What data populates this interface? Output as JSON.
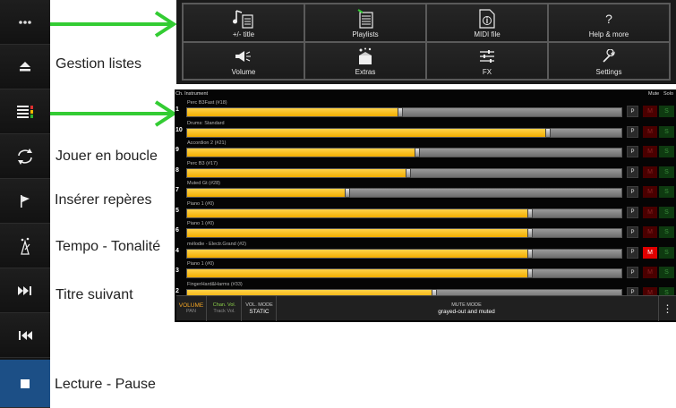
{
  "sidebar": {
    "buttons": [
      {
        "name": "more-icon"
      },
      {
        "name": "eject-icon"
      },
      {
        "name": "playlist-icon"
      },
      {
        "name": "loop-icon"
      },
      {
        "name": "flag-icon"
      },
      {
        "name": "tempo-icon"
      },
      {
        "name": "next-track-icon"
      },
      {
        "name": "restart-icon"
      },
      {
        "name": "stop-icon"
      }
    ]
  },
  "annotations": {
    "gestion_listes": "Gestion listes",
    "jouer_en_boucle": "Jouer en boucle",
    "inserer_reperes": "Insérer repères",
    "tempo_tonalite": "Tempo - Tonalité",
    "titre_suivant": "Titre suivant",
    "lecture_pause": "Lecture - Pause"
  },
  "menu": {
    "items": [
      {
        "label": "+/- title",
        "icon": "add-title-icon"
      },
      {
        "label": "Playlists",
        "icon": "playlists-icon"
      },
      {
        "label": "MIDI file",
        "icon": "midi-file-icon"
      },
      {
        "label": "Help & more",
        "icon": "help-icon"
      },
      {
        "label": "Volume",
        "icon": "volume-icon"
      },
      {
        "label": "Extras",
        "icon": "extras-icon"
      },
      {
        "label": "FX",
        "icon": "fx-icon"
      },
      {
        "label": "Settings",
        "icon": "settings-icon"
      }
    ]
  },
  "mixer": {
    "header": {
      "ch_instrument": "Ch. Instrument",
      "mute": "Mute",
      "solo": "Solo"
    },
    "rows": [
      {
        "channel": "1",
        "instrument": "Perc B3Fast (#18)",
        "level": 0.49,
        "muted": false
      },
      {
        "channel": "10",
        "instrument": "Drums: Standard",
        "level": 0.83,
        "muted": false
      },
      {
        "channel": "9",
        "instrument": "Accordion 2 (#21)",
        "level": 0.53,
        "muted": false
      },
      {
        "channel": "8",
        "instrument": "Perc B3 (#17)",
        "level": 0.51,
        "muted": false
      },
      {
        "channel": "7",
        "instrument": "Muted Gt (#28)",
        "level": 0.37,
        "muted": false
      },
      {
        "channel": "5",
        "instrument": "Piano 1 (#0)",
        "level": 0.79,
        "muted": false
      },
      {
        "channel": "6",
        "instrument": "Piano 1 (#0)",
        "level": 0.79,
        "muted": false
      },
      {
        "channel": "4",
        "instrument": "mélodie - Electr.Grand (#2)",
        "level": 0.79,
        "muted": true
      },
      {
        "channel": "3",
        "instrument": "Piano 1 (#0)",
        "level": 0.79,
        "muted": false
      },
      {
        "channel": "2",
        "instrument": "FingerHard&Harms (#33)",
        "level": 0.57,
        "muted": false
      }
    ],
    "buttons": {
      "p": "P",
      "m": "M",
      "s": "S"
    }
  },
  "bottombar": {
    "volume": "VOLUME",
    "pan": "PAN",
    "chan_vol": "Chan. Vol.",
    "track_vol": "Track Vol.",
    "vol_mode_label": "VOL. MODE",
    "vol_mode_value": "STATIC",
    "mute_mode_label": "MUTE MODE",
    "mute_mode_value": "grayed-out and muted",
    "overflow": "⋮"
  },
  "colors": {
    "accent_arrow": "#33cc33",
    "fader_fill": "#f5b800",
    "mute_on": "#e00000",
    "stop_button": "#1c4f86"
  }
}
